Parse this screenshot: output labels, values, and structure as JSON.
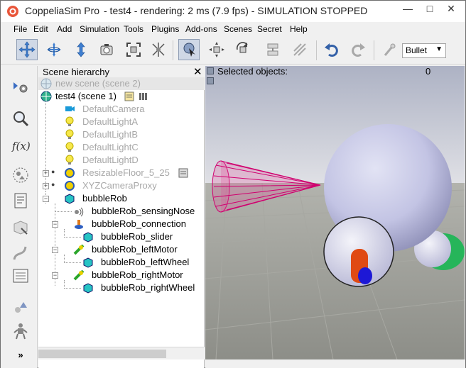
{
  "window": {
    "app_name": "CoppeliaSim Pro",
    "subtitle": "- test4 - rendering: 2 ms (7.9 fps) - SIMULATION STOPPED",
    "minimize": "—",
    "maximize": "□",
    "close": "✕"
  },
  "menu": [
    "File",
    "Edit",
    "Add",
    "Simulation",
    "Tools",
    "Plugins",
    "Add-ons",
    "Scenes",
    "Secret",
    "Help"
  ],
  "toolbar": {
    "icons": [
      "move-view-icon",
      "rotate-view-icon",
      "shift-view-icon",
      "camera-angle-icon",
      "fit-to-view-icon",
      "manipulate-icon",
      "object-select-icon",
      "object-shift-icon",
      "object-rotate-icon",
      "assemble-icon",
      "transfer-dna-icon",
      "undo-icon",
      "redo-icon",
      "dynamics-icon"
    ],
    "physics_engine": "Bullet"
  },
  "leftbar": {
    "icons": [
      "object-properties-icon",
      "search-icon",
      "calculation-modules-icon",
      "collections-icon",
      "scripts-icon",
      "shapes-edit-icon",
      "path-edit-icon",
      "selection-icon",
      "model-browser-icon",
      "scene-hierarchy-icon",
      "more-icon"
    ]
  },
  "hierarchy": {
    "title": "Scene hierarchy",
    "close": "✕",
    "scenes": [
      {
        "label": "new scene (scene 2)"
      },
      {
        "label": "test4 (scene 1)"
      }
    ],
    "items": [
      {
        "label": "DefaultCamera"
      },
      {
        "label": "DefaultLightA"
      },
      {
        "label": "DefaultLightB"
      },
      {
        "label": "DefaultLightC"
      },
      {
        "label": "DefaultLightD"
      },
      {
        "label": "ResizableFloor_5_25"
      },
      {
        "label": "XYZCameraProxy"
      },
      {
        "label": "bubbleRob"
      },
      {
        "label": "bubbleRob_sensingNose"
      },
      {
        "label": "bubbleRob_connection"
      },
      {
        "label": "bubbleRob_slider"
      },
      {
        "label": "bubbleRob_leftMotor"
      },
      {
        "label": "bubbleRob_leftWheel"
      },
      {
        "label": "bubbleRob_rightMotor"
      },
      {
        "label": "bubbleRob_rightWheel"
      }
    ]
  },
  "viewport": {
    "selected_label": "Selected objects:",
    "selected_count": "0"
  },
  "colors": {
    "sky_top": "#b4b9c9",
    "sky_bottom": "#e8e9ec",
    "floor": "#9c9d97",
    "robot_body": "#c7c8e6",
    "sensor_cone": "#d0006f",
    "motor": "#e04a14",
    "motor_inner": "#1d18d6",
    "accent_green": "#26b55a"
  }
}
